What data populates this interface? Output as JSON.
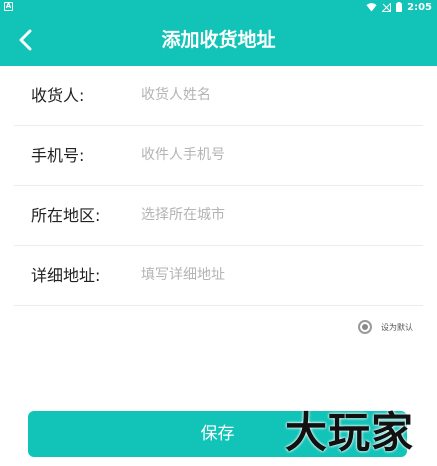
{
  "status_bar": {
    "app_indicator": "A",
    "time": "2:05",
    "icons": [
      "wifi-icon",
      "signal-off-icon",
      "battery-icon"
    ]
  },
  "header": {
    "title": "添加收货地址",
    "back_icon": "chevron-left-icon"
  },
  "form": {
    "fields": [
      {
        "label": "收货人:",
        "placeholder": "收货人姓名",
        "value": ""
      },
      {
        "label": "手机号:",
        "placeholder": "收件人手机号",
        "value": ""
      },
      {
        "label": "所在地区:",
        "placeholder": "选择所在城市",
        "value": ""
      },
      {
        "label": "详细地址:",
        "placeholder": "填写详细地址",
        "value": ""
      }
    ]
  },
  "default_option": {
    "label": "设为默认",
    "selected": true
  },
  "save_button": {
    "label": "保存"
  },
  "watermark": {
    "text": "大玩家"
  },
  "colors": {
    "accent": "#12c3b8",
    "label_text": "#222222",
    "placeholder": "#b4b4b4",
    "divider": "#ececec"
  }
}
